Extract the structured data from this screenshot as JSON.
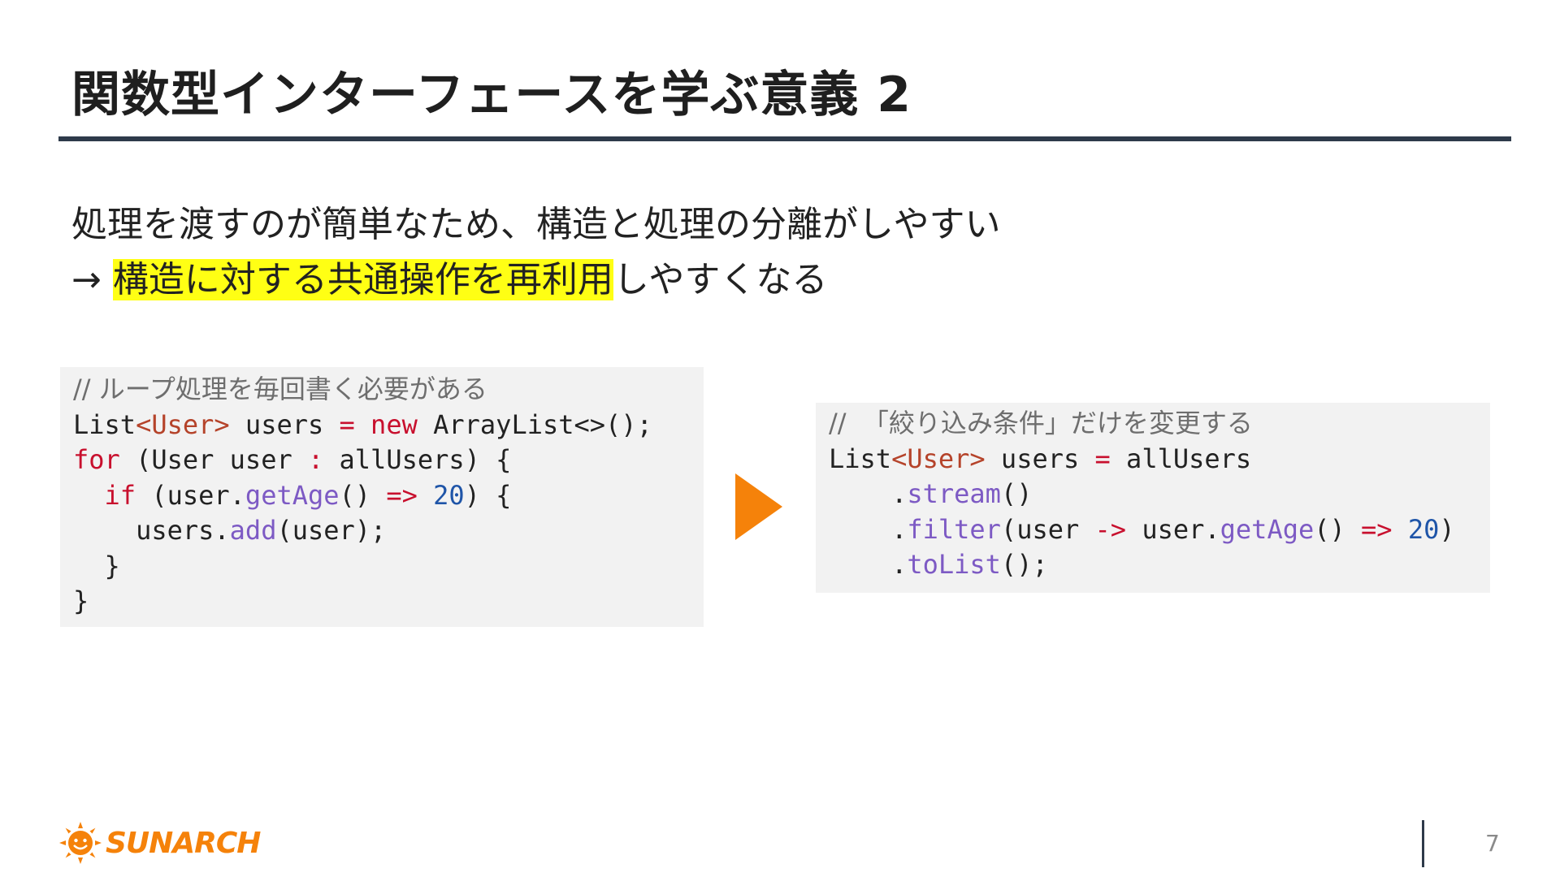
{
  "slide": {
    "title": "関数型インターフェースを学ぶ意義 2",
    "lead_line1": "処理を渡すのが簡単なため、構造と処理の分離がしやすい",
    "lead_line2_prefix": "→ ",
    "lead_line2_highlight": "構造に対する共通操作を再利用",
    "lead_line2_suffix": "しやすくなる",
    "page_number": "7"
  },
  "code_left": {
    "comment": "// ループ処理を毎回書く必要がある",
    "l2": {
      "a": "List",
      "b": "<User>",
      "c": " users ",
      "d": "=",
      "e": " ",
      "f": "new",
      "g": " ArrayList<>();"
    },
    "l3": {
      "a": "for",
      "b": " (User user ",
      "c": ":",
      "d": " allUsers) {"
    },
    "l4": {
      "a": "  ",
      "b": "if",
      "c": " (user.",
      "d": "getAge",
      "e": "() ",
      "f": "=>",
      "g": " ",
      "h": "20",
      "i": ") {"
    },
    "l5": {
      "a": "    users.",
      "b": "add",
      "c": "(user);"
    },
    "l6": "  }",
    "l7": "}"
  },
  "code_right": {
    "comment": "//  「絞り込み条件」だけを変更する",
    "l2": {
      "a": "List",
      "b": "<User>",
      "c": " users ",
      "d": "=",
      "e": " allUsers"
    },
    "l3": {
      "a": "    .",
      "b": "stream",
      "c": "()"
    },
    "l4": {
      "a": "    .",
      "b": "filter",
      "c": "(user ",
      "d": "->",
      "e": " user.",
      "f": "getAge",
      "g": "() ",
      "h": "=>",
      "i": " ",
      "j": "20",
      "k": ")"
    },
    "l5": {
      "a": "    .",
      "b": "toList",
      "c": "();"
    }
  },
  "logo": {
    "text": "SUNARCH"
  },
  "colors": {
    "accent": "#f5820a",
    "highlight": "#ffff14",
    "rule": "#2e3a4a"
  },
  "icons": {
    "arrow": "play-triangle-icon",
    "logo": "sun-icon"
  }
}
